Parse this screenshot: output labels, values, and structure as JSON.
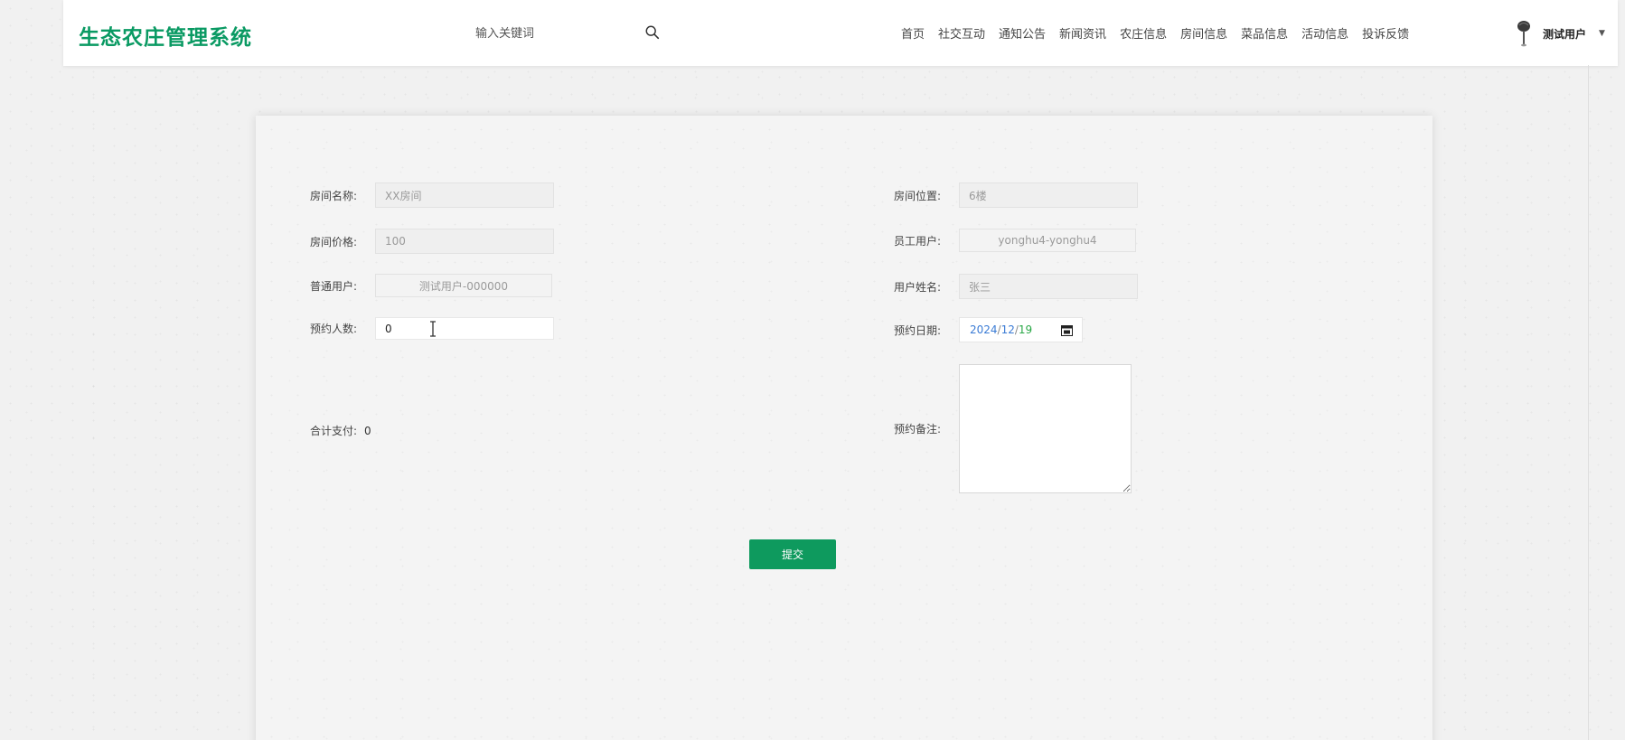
{
  "header": {
    "brand": "生态农庄管理系统",
    "search": {
      "placeholder": "输入关键词",
      "icon": "search-icon"
    },
    "nav": [
      {
        "label": "首页"
      },
      {
        "label": "社交互动"
      },
      {
        "label": "通知公告"
      },
      {
        "label": "新闻资讯"
      },
      {
        "label": "农庄信息"
      },
      {
        "label": "房间信息"
      },
      {
        "label": "菜品信息"
      },
      {
        "label": "活动信息"
      },
      {
        "label": "投诉反馈"
      }
    ],
    "user": {
      "name": "测试用户",
      "caret": "▼"
    }
  },
  "form": {
    "room_name": {
      "label": "房间名称:",
      "value": "XX房间"
    },
    "room_location": {
      "label": "房间位置:",
      "value": "6楼"
    },
    "room_price": {
      "label": "房间价格:",
      "value": "100"
    },
    "staff_user": {
      "label": "员工用户:",
      "value": "yonghu4-yonghu4"
    },
    "normal_user": {
      "label": "普通用户:",
      "value": "测试用户-000000"
    },
    "user_name": {
      "label": "用户姓名:",
      "value": "张三"
    },
    "guest_count": {
      "label": "预约人数:",
      "value": "0"
    },
    "booking_date": {
      "label": "预约日期:",
      "year": "2024",
      "month": "12",
      "day": "19",
      "sep": "/"
    },
    "total_pay": {
      "label": "合计支付:",
      "value": "0"
    },
    "remark": {
      "label": "预约备注:",
      "value": ""
    },
    "submit_label": "提交"
  },
  "colors": {
    "brand": "#0a9a63",
    "button": "#0e9a5e"
  }
}
